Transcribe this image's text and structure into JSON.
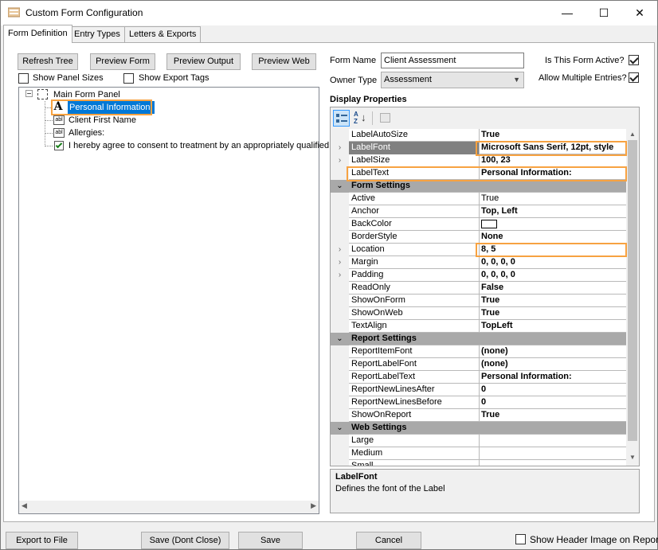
{
  "window": {
    "title": "Custom Form Configuration",
    "controls": {
      "minimize": "—",
      "maximize": "☐",
      "close": "✕"
    }
  },
  "tabs": [
    {
      "label": "Form Definition",
      "active": true
    },
    {
      "label": "Entry Types",
      "active": false
    },
    {
      "label": "Letters & Exports",
      "active": false
    }
  ],
  "toolbar": {
    "refresh_tree": "Refresh Tree",
    "preview_form": "Preview Form",
    "preview_output": "Preview Output",
    "preview_web": "Preview Web"
  },
  "options": {
    "show_panel_sizes": {
      "label": "Show Panel Sizes",
      "checked": false
    },
    "show_export_tags": {
      "label": "Show Export Tags",
      "checked": false
    }
  },
  "tree": {
    "root": "Main Form Panel",
    "items": [
      {
        "icon": "label-a-icon",
        "label": "Personal Information:",
        "selected": true
      },
      {
        "icon": "textbox-icon",
        "glyph": "abl",
        "label": "Client First Name"
      },
      {
        "icon": "textbox-icon",
        "glyph": "abl",
        "label": "Allergies:"
      },
      {
        "icon": "checkbox-item-icon",
        "label": "I hereby agree to consent to treatment by an appropriately qualified"
      }
    ]
  },
  "form": {
    "name_label": "Form Name",
    "name_value": "Client Assessment",
    "owner_type_label": "Owner Type",
    "owner_type_value": "Assessment",
    "is_active_label": "Is This Form Active?",
    "is_active_checked": true,
    "allow_multiple_label": "Allow Multiple Entries?",
    "allow_multiple_checked": true
  },
  "display_properties": {
    "heading": "Display Properties",
    "rows": [
      {
        "type": "prop",
        "name": "LabelAutoSize",
        "value": "True",
        "bold": true
      },
      {
        "type": "prop",
        "name": "LabelFont",
        "value": "Microsoft Sans Serif, 12pt, style",
        "bold": true,
        "expandable": true,
        "selected": true
      },
      {
        "type": "prop",
        "name": "LabelSize",
        "value": "100, 23",
        "bold": true,
        "expandable": true
      },
      {
        "type": "prop",
        "name": "LabelText",
        "value": "Personal Information:",
        "bold": true
      },
      {
        "type": "cat",
        "name": "Form Settings"
      },
      {
        "type": "prop",
        "name": "Active",
        "value": "True",
        "bold": false
      },
      {
        "type": "prop",
        "name": "Anchor",
        "value": "Top, Left",
        "bold": true
      },
      {
        "type": "prop",
        "name": "BackColor",
        "value": "",
        "swatch": true
      },
      {
        "type": "prop",
        "name": "BorderStyle",
        "value": "None",
        "bold": true
      },
      {
        "type": "prop",
        "name": "Location",
        "value": "8, 5",
        "bold": true,
        "expandable": true
      },
      {
        "type": "prop",
        "name": "Margin",
        "value": "0, 0, 0, 0",
        "bold": true,
        "expandable": true
      },
      {
        "type": "prop",
        "name": "Padding",
        "value": "0, 0, 0, 0",
        "bold": true,
        "expandable": true
      },
      {
        "type": "prop",
        "name": "ReadOnly",
        "value": "False",
        "bold": true
      },
      {
        "type": "prop",
        "name": "ShowOnForm",
        "value": "True",
        "bold": true
      },
      {
        "type": "prop",
        "name": "ShowOnWeb",
        "value": "True",
        "bold": true
      },
      {
        "type": "prop",
        "name": "TextAlign",
        "value": "TopLeft",
        "bold": true
      },
      {
        "type": "cat",
        "name": "Report Settings"
      },
      {
        "type": "prop",
        "name": "ReportItemFont",
        "value": "(none)",
        "bold": true
      },
      {
        "type": "prop",
        "name": "ReportLabelFont",
        "value": "(none)",
        "bold": true
      },
      {
        "type": "prop",
        "name": "ReportLabelText",
        "value": "Personal Information:",
        "bold": true
      },
      {
        "type": "prop",
        "name": "ReportNewLinesAfter",
        "value": "0",
        "bold": true
      },
      {
        "type": "prop",
        "name": "ReportNewLinesBefore",
        "value": "0",
        "bold": true
      },
      {
        "type": "prop",
        "name": "ShowOnReport",
        "value": "True",
        "bold": true
      },
      {
        "type": "cat",
        "name": "Web Settings"
      },
      {
        "type": "prop",
        "name": "Large",
        "value": "",
        "bold": false
      },
      {
        "type": "prop",
        "name": "Medium",
        "value": "",
        "bold": false
      },
      {
        "type": "prop",
        "name": "Small",
        "value": "",
        "bold": false
      }
    ],
    "description_title": "LabelFont",
    "description_text": "Defines the font of the Label"
  },
  "footer": {
    "export_to_file": "Export to File",
    "save_dont_close": "Save (Dont Close)",
    "save": "Save",
    "cancel": "Cancel",
    "show_header_image_label": "Show Header Image on Report?",
    "show_header_image_checked": false
  },
  "colors": {
    "highlight": "#f7a241",
    "selection": "#0078d7",
    "category": "#a9a9a9"
  }
}
